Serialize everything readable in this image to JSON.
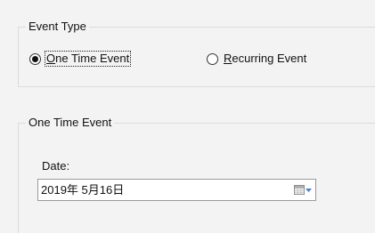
{
  "event_type": {
    "legend": "Event Type",
    "options": [
      {
        "label": "One Time Event",
        "mnemonic": "O",
        "rest": "ne Time Event",
        "selected": true
      },
      {
        "label": "Recurring Event",
        "mnemonic": "R",
        "rest": "ecurring Event",
        "selected": false
      }
    ]
  },
  "one_time": {
    "legend": "One Time Event",
    "date_label": "Date:",
    "date_value": "2019年  5月16日",
    "picker_icon": "calendar-dropdown-icon"
  },
  "colors": {
    "background": "#f3f3f3",
    "group_border": "#dcdcdc",
    "field_border": "#9a9a9a",
    "icon_accent": "#4a7fcf"
  }
}
